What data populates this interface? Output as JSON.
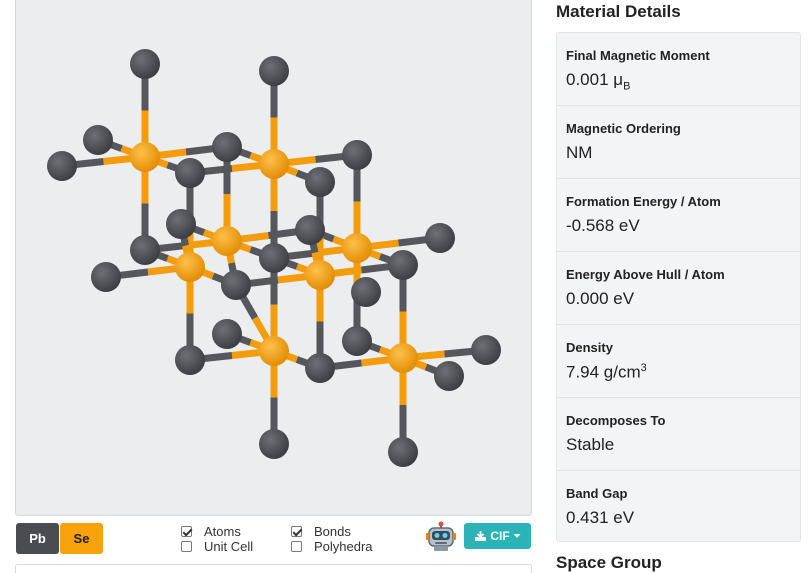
{
  "legend": {
    "elements": [
      {
        "symbol": "Pb",
        "color": "#4b4c52"
      },
      {
        "symbol": "Se",
        "color": "#f7a20a"
      }
    ]
  },
  "toggles": {
    "atoms": {
      "label": "Atoms",
      "checked": true
    },
    "unit_cell": {
      "label": "Unit Cell",
      "checked": false
    },
    "bonds": {
      "label": "Bonds",
      "checked": true
    },
    "polyhedra": {
      "label": "Polyhedra",
      "checked": false
    }
  },
  "toolbar": {
    "robot_icon": "robot-icon",
    "download_label": "CIF",
    "download_icon": "download-icon"
  },
  "details": {
    "title": "Material Details",
    "items": [
      {
        "label": "Final Magnetic Moment",
        "value": "0.001 μ",
        "sub": "B"
      },
      {
        "label": "Magnetic Ordering",
        "value": "NM"
      },
      {
        "label": "Formation Energy / Atom",
        "value": "-0.568 eV"
      },
      {
        "label": "Energy Above Hull / Atom",
        "value": "0.000 eV"
      },
      {
        "label": "Density",
        "value": "7.94 g/cm",
        "sup": "3"
      },
      {
        "label": "Decomposes To",
        "value": "Stable"
      },
      {
        "label": "Band Gap",
        "value": "0.431 eV"
      }
    ]
  },
  "next_section": {
    "title": "Space Group"
  },
  "colors": {
    "pb": "#47484d",
    "se": "#f39c0c",
    "bond_pb": "#55575c",
    "bond_se": "#f39c0c",
    "accent": "#2cb3b8"
  }
}
